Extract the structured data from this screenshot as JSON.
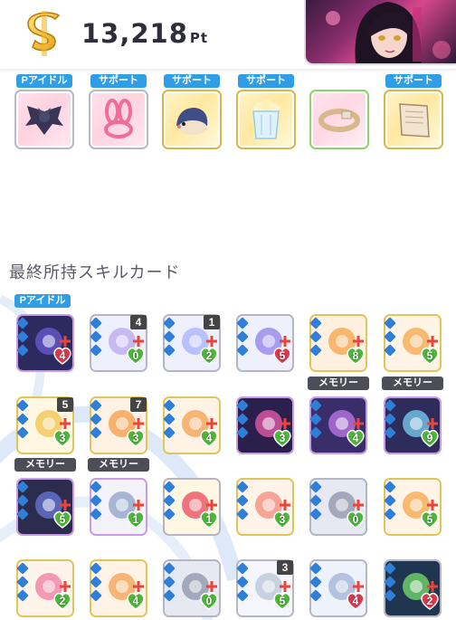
{
  "header": {
    "points_value": "13,218",
    "points_unit": "Pt",
    "coin_icon": "s-coin-icon",
    "portrait": "character-portrait"
  },
  "colors": {
    "tag_blue": "#2f9ee6",
    "tag_dark": "#4d4d57",
    "cost_green": "#4fb53c",
    "cost_red": "#d9394c",
    "accent_pink": "#ffd2e0"
  },
  "items": [
    {
      "tag": "Pアイドル",
      "icon": "bat-wing-icon"
    },
    {
      "tag": "サポート",
      "icon": "bunny-ribbon-icon"
    },
    {
      "tag": "サポート",
      "icon": "hedgehog-plush-icon"
    },
    {
      "tag": "サポート",
      "icon": "popcorn-cup-icon"
    },
    {
      "tag": "",
      "icon": "bracelet-icon"
    },
    {
      "tag": "サポート",
      "icon": "notebook-icon"
    }
  ],
  "section_title": "最終所持スキルカード",
  "cards": [
    {
      "tag": "Pアイドル",
      "num": "",
      "cost": "4",
      "cost_type": "red",
      "art": "idol-portrait-card"
    },
    {
      "tag": "",
      "num": "4",
      "cost": "0",
      "cost_type": "green",
      "art": "lightbulb-card"
    },
    {
      "tag": "",
      "num": "1",
      "cost": "2",
      "cost_type": "green",
      "art": "sparkle-burst-card"
    },
    {
      "tag": "",
      "num": "",
      "cost": "5",
      "cost_type": "red",
      "art": "star-swirl-card"
    },
    {
      "tag": "",
      "num": "",
      "cost": "8",
      "cost_type": "green",
      "art": "hand-flower-card"
    },
    {
      "tag": "",
      "num": "",
      "cost": "5",
      "cost_type": "green",
      "art": "clap-hands-card"
    },
    {
      "tag": "",
      "num": "5",
      "cost": "3",
      "cost_type": "green",
      "art": "candy-bottle-card"
    },
    {
      "tag": "",
      "num": "7",
      "cost": "3",
      "cost_type": "green",
      "art": "wave-hand-card"
    },
    {
      "tag": "",
      "num": "",
      "cost": "4",
      "cost_type": "green",
      "art": "pray-hands-card"
    },
    {
      "tag": "",
      "num": "",
      "cost": "3",
      "cost_type": "green",
      "art": "neon-stars-card"
    },
    {
      "tag": "メモリー",
      "num": "",
      "cost": "4",
      "cost_type": "green",
      "art": "memory-crystal-card"
    },
    {
      "tag": "メモリー",
      "num": "",
      "cost": "9",
      "cost_type": "green",
      "art": "memory-stage-card"
    },
    {
      "tag": "メモリー",
      "num": "",
      "cost": "5",
      "cost_type": "green",
      "art": "memory-silhouette-card"
    },
    {
      "tag": "メモリー",
      "num": "",
      "cost": "1",
      "cost_type": "green",
      "art": "memory-girl-card"
    },
    {
      "tag": "",
      "num": "",
      "cost": "1",
      "cost_type": "green",
      "art": "flower-bouquet-card"
    },
    {
      "tag": "",
      "num": "",
      "cost": "3",
      "cost_type": "green",
      "art": "hand-touch-card"
    },
    {
      "tag": "",
      "num": "",
      "cost": "0",
      "cost_type": "green",
      "art": "locked-emblem-card"
    },
    {
      "tag": "",
      "num": "",
      "cost": "5",
      "cost_type": "green",
      "art": "clap-hands-card"
    },
    {
      "tag": "",
      "num": "",
      "cost": "2",
      "cost_type": "green",
      "art": "idol-group-card"
    },
    {
      "tag": "",
      "num": "",
      "cost": "4",
      "cost_type": "green",
      "art": "pray-hands-card"
    },
    {
      "tag": "",
      "num": "",
      "cost": "0",
      "cost_type": "green",
      "art": "locked-emblem-card"
    },
    {
      "tag": "",
      "num": "3",
      "cost": "5",
      "cost_type": "green",
      "art": "sketch-paper-card"
    },
    {
      "tag": "",
      "num": "",
      "cost": "4",
      "cost_type": "red",
      "art": "heart-hands-card"
    },
    {
      "tag": "",
      "num": "",
      "cost": "2",
      "cost_type": "red",
      "art": "concert-lights-card"
    }
  ]
}
